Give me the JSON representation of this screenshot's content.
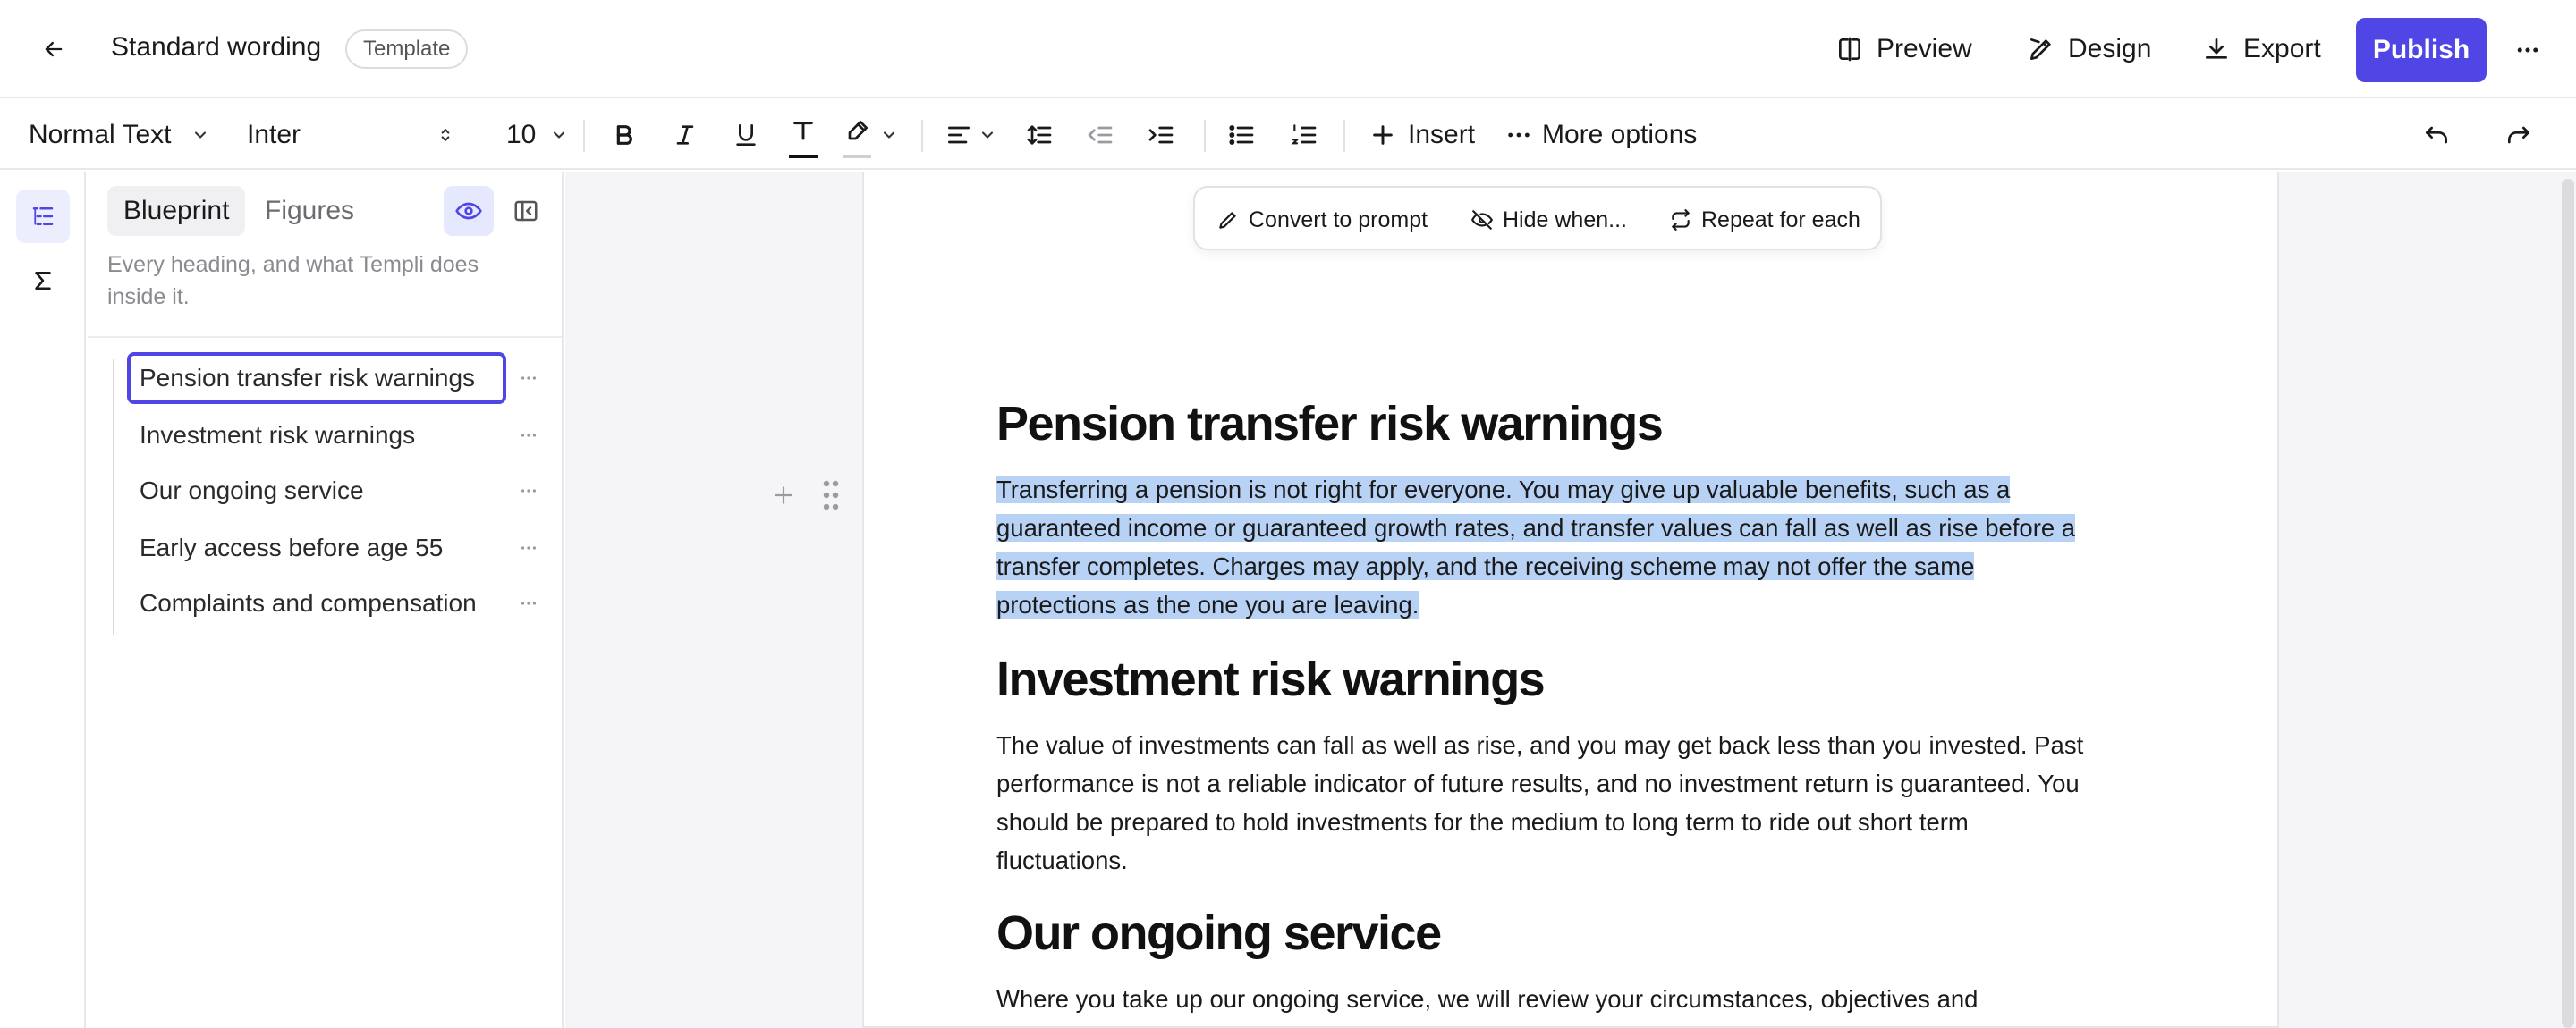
{
  "header": {
    "title": "Standard wording",
    "badge": "Template",
    "preview_label": "Preview",
    "design_label": "Design",
    "export_label": "Export",
    "publish_label": "Publish",
    "accent_color": "#4f46e5"
  },
  "toolbar": {
    "style_value": "Normal Text",
    "font_value": "Inter",
    "size_value": "10",
    "insert_label": "Insert",
    "more_options_label": "More options"
  },
  "panel": {
    "tabs": [
      {
        "label": "Blueprint",
        "active": true
      },
      {
        "label": "Figures",
        "active": false
      }
    ],
    "description": "Every heading, and what Templi does inside it.",
    "outline": [
      {
        "label": "Pension transfer risk warnings",
        "selected": true
      },
      {
        "label": "Investment risk warnings",
        "selected": false
      },
      {
        "label": "Our ongoing service",
        "selected": false
      },
      {
        "label": "Early access before age 55",
        "selected": false
      },
      {
        "label": "Complaints and compensation",
        "selected": false
      }
    ]
  },
  "floating_bar": {
    "convert_label": "Convert to prompt",
    "hide_label": "Hide when...",
    "repeat_label": "Repeat for each"
  },
  "document": {
    "sections": [
      {
        "heading": "Pension transfer risk warnings",
        "lines": [
          "Transferring a pension is not right for everyone. You may give up valuable benefits, such as a",
          "guaranteed income or guaranteed growth rates, and transfer values can fall as well as rise before a",
          "transfer completes. Charges may apply, and the receiving scheme may not offer the same",
          "protections as the one you are leaving."
        ]
      },
      {
        "heading": "Investment risk warnings",
        "lines": [
          "The value of investments can fall as well as rise, and you may get back less than you invested. Past",
          "performance is not a reliable indicator of future results, and no investment return is guaranteed. You",
          "should be prepared to hold investments for the medium to long term to ride out short term",
          "fluctuations."
        ]
      },
      {
        "heading": "Our ongoing service",
        "lines": [
          "Where you take up our ongoing service, we will review your circumstances, objectives and"
        ]
      }
    ]
  }
}
